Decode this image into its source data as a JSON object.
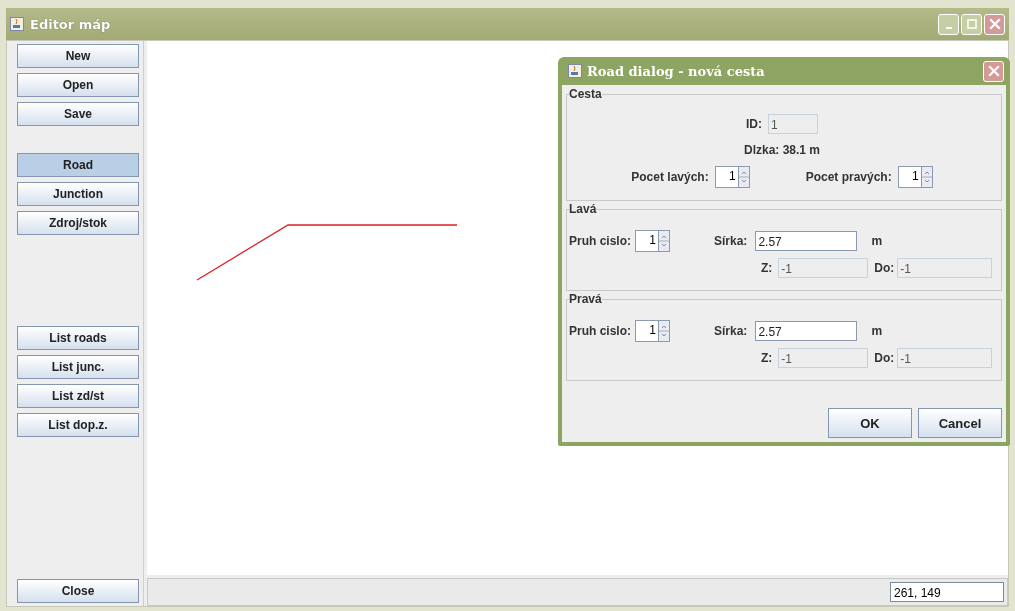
{
  "window": {
    "title": "Editor máp"
  },
  "sidebar": {
    "groups": [
      [
        {
          "label": "New",
          "selected": false
        },
        {
          "label": "Open",
          "selected": false
        },
        {
          "label": "Save",
          "selected": false
        }
      ],
      [
        {
          "label": "Road",
          "selected": true
        },
        {
          "label": "Junction",
          "selected": false
        },
        {
          "label": "Zdroj/stok",
          "selected": false
        }
      ],
      [
        {
          "label": "List roads",
          "selected": false
        },
        {
          "label": "List junc.",
          "selected": false
        },
        {
          "label": "List zd/st",
          "selected": false
        },
        {
          "label": "List dop.z.",
          "selected": false
        }
      ]
    ],
    "close_button": "Close"
  },
  "status_bar": {
    "coordinates": "261, 149"
  },
  "dialog": {
    "title": "Road dialog - nová cesta",
    "road": {
      "legend": "Cesta",
      "id_label": "ID:",
      "id_value": "1",
      "length": "Dlzka: 38.1 m",
      "left_count": {
        "label": "Pocet lavých:",
        "value": "1"
      },
      "right_count": {
        "label": "Pocet pravých:",
        "value": "1"
      }
    },
    "lanes": [
      {
        "legend": "Lavá",
        "lane_label": "Pruh cislo:",
        "lane_value": "1",
        "width_label": "Sírka:",
        "width_value": "2.57",
        "unit": "m",
        "from_label": "Z:",
        "from_value": "-1",
        "to_label": "Do:",
        "to_value": "-1"
      },
      {
        "legend": "Pravá",
        "lane_label": "Pruh cislo:",
        "lane_value": "1",
        "width_label": "Sírka:",
        "width_value": "2.57",
        "unit": "m",
        "from_label": "Z:",
        "from_value": "-1",
        "to_label": "Do:",
        "to_value": "-1"
      }
    ],
    "buttons": [
      "OK",
      "Cancel"
    ]
  }
}
